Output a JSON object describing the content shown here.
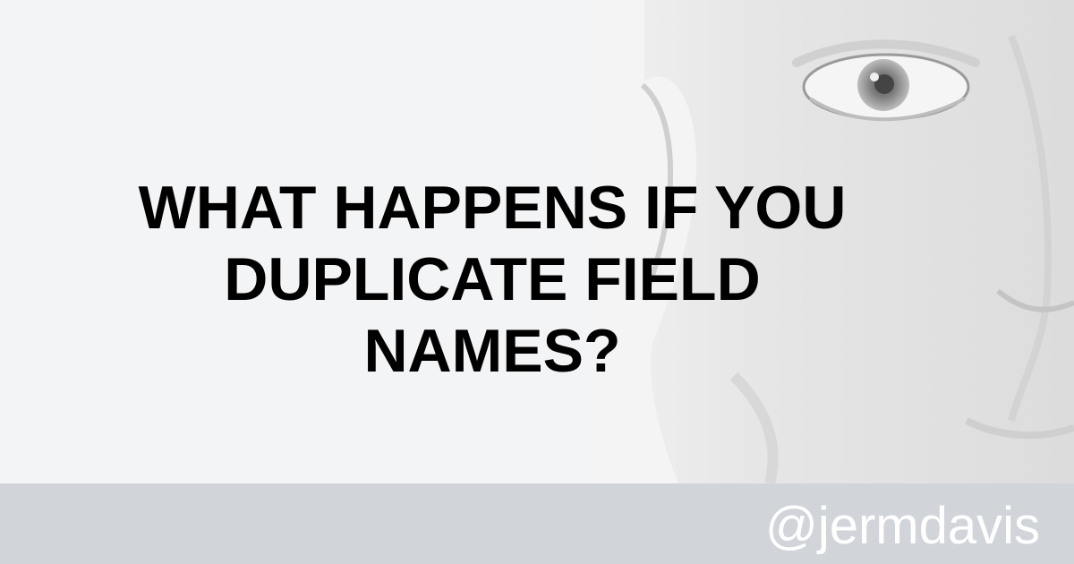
{
  "title": {
    "lines": [
      "WHAT HAPPENS IF YOU",
      "DUPLICATE FIELD",
      "NAMES?"
    ]
  },
  "footer": {
    "handle": "@jermdavis"
  },
  "photo": {
    "subject": "face-photo"
  },
  "colors": {
    "background": "#f3f4f6",
    "footer": "#d1d5da",
    "title_text": "#000000",
    "handle_text": "#ffffff"
  }
}
